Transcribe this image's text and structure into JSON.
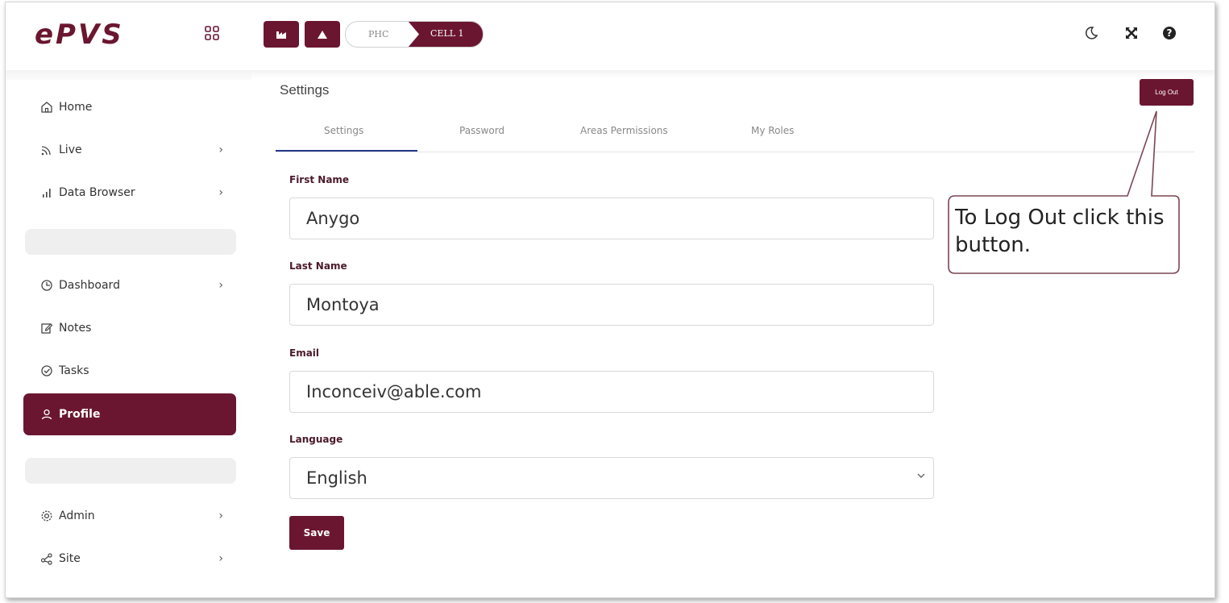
{
  "app": {
    "logo": "ePVS"
  },
  "breadcrumb": {
    "level_1": "PHC",
    "level_2": "CELL 1"
  },
  "sidebar": {
    "items": [
      {
        "label": "Home",
        "icon": "home-icon",
        "chevron": false
      },
      {
        "label": "Live",
        "icon": "rss-icon",
        "chevron": true
      },
      {
        "label": "Data Browser",
        "icon": "bar-chart-icon",
        "chevron": true
      },
      {
        "label": "Dashboard",
        "icon": "clock-icon",
        "chevron": true
      },
      {
        "label": "Notes",
        "icon": "edit-icon",
        "chevron": false
      },
      {
        "label": "Tasks",
        "icon": "check-circle-icon",
        "chevron": false
      },
      {
        "label": "Profile",
        "icon": "user-icon",
        "chevron": false,
        "active": true
      },
      {
        "label": "Admin",
        "icon": "gear-icon",
        "chevron": true
      },
      {
        "label": "Site",
        "icon": "share-icon",
        "chevron": true
      }
    ],
    "chevron": "›"
  },
  "main": {
    "title": "Settings",
    "logout_label": "Log Out",
    "tabs": [
      {
        "label": "Settings",
        "active": true
      },
      {
        "label": "Password"
      },
      {
        "label": "Areas Permissions"
      },
      {
        "label": "My Roles"
      }
    ],
    "form": {
      "first_name": {
        "label": "First Name",
        "value": "Anygo"
      },
      "last_name": {
        "label": "Last Name",
        "value": "Montoya"
      },
      "email": {
        "label": "Email",
        "value": "Inconceiv@able.com"
      },
      "language": {
        "label": "Language",
        "value": "English"
      },
      "save_label": "Save"
    }
  },
  "callout": {
    "text": "To Log Out click this button."
  },
  "colors": {
    "brand": "#6b1630",
    "tab_active": "#24388a"
  }
}
